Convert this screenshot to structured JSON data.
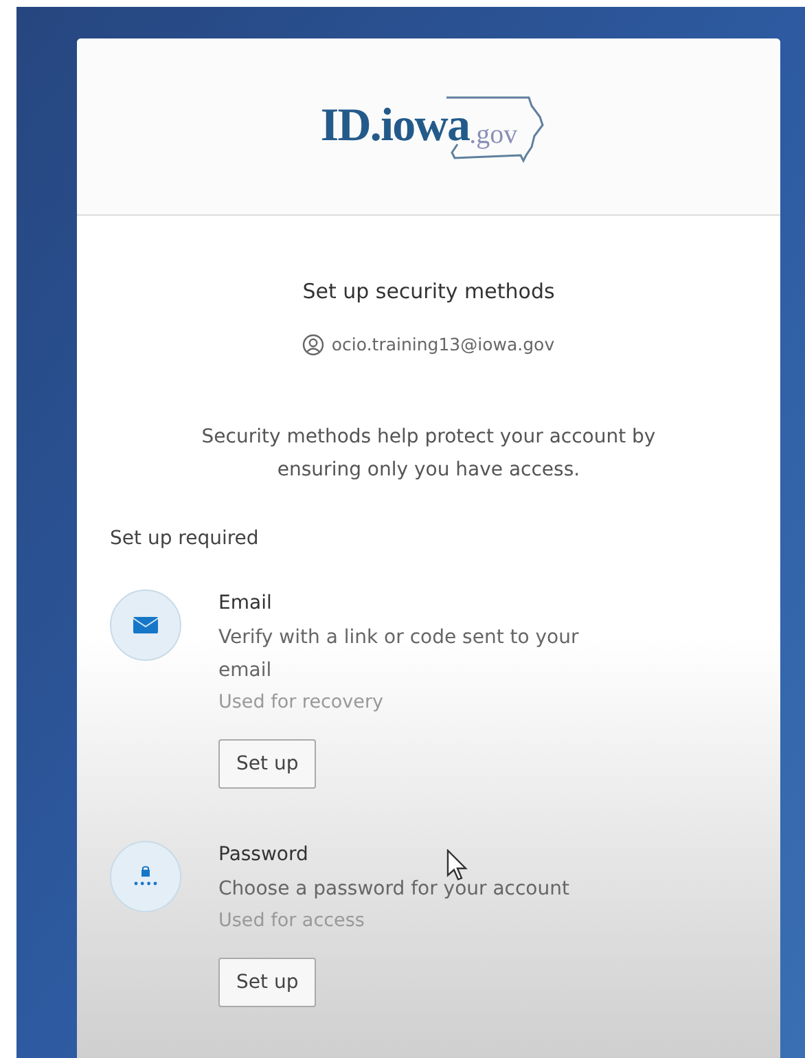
{
  "logo": {
    "name": "ID.iowa",
    "suffix": ".gov"
  },
  "title": "Set up security methods",
  "account": "ocio.training13@iowa.gov",
  "description": "Security methods help protect your account by ensuring only you have access.",
  "section": "Set up required",
  "methods": [
    {
      "kind": "email",
      "name": "Email",
      "description": "Verify with a link or code sent to your email",
      "usage": "Used for recovery",
      "button": "Set up"
    },
    {
      "kind": "password",
      "name": "Password",
      "description": "Choose a password for your account",
      "usage": "Used for access",
      "button": "Set up"
    }
  ]
}
